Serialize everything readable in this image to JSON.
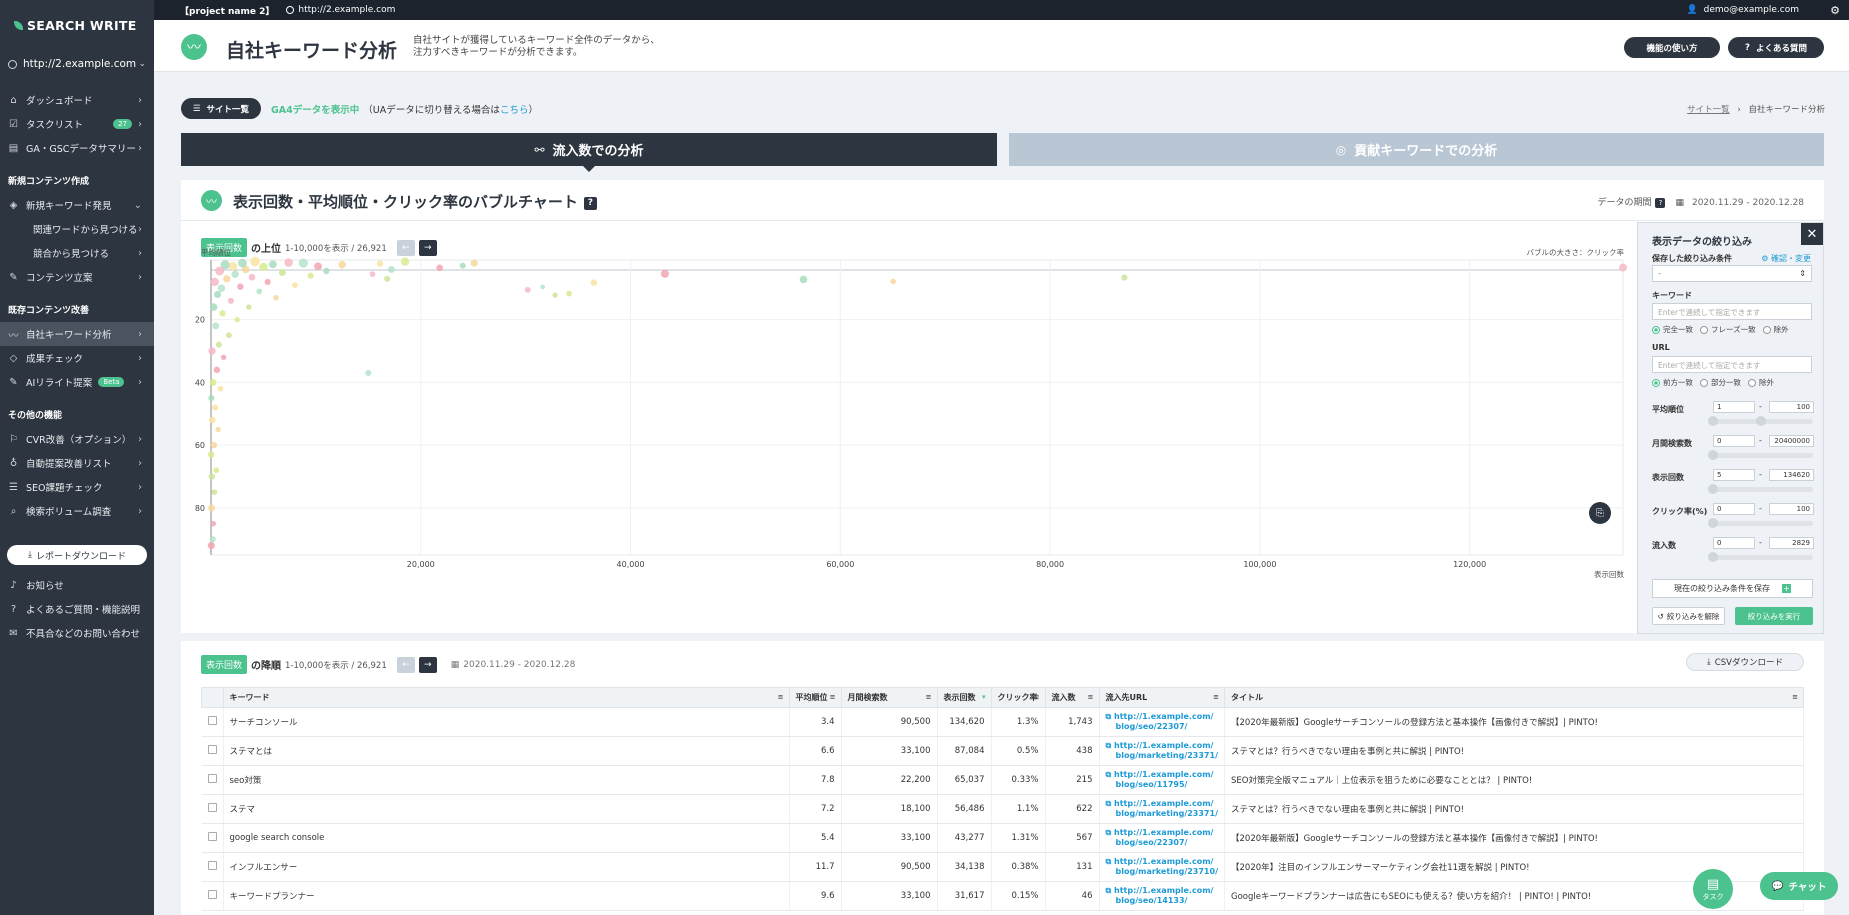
{
  "sidebar": {
    "logo": "SEARCH WRITE",
    "site": "http://2.example.com",
    "items_top": [
      {
        "label": "ダッシュボード",
        "icon": "home-icon"
      },
      {
        "label": "タスクリスト",
        "icon": "checklist-icon",
        "badge": "27"
      },
      {
        "label": "GA・GSCデータサマリー",
        "icon": "chart-icon"
      }
    ],
    "section_new": "新規コンテンツ作成",
    "items_new": [
      {
        "label": "新規キーワード発見",
        "sub": false
      },
      {
        "label": "関連ワードから見つける",
        "sub": true
      },
      {
        "label": "競合から見つける",
        "sub": true
      },
      {
        "label": "コンテンツ立案",
        "sub": false
      }
    ],
    "section_existing": "既存コンテンツ改善",
    "items_existing": [
      {
        "label": "自社キーワード分析",
        "active": true
      },
      {
        "label": "成果チェック"
      },
      {
        "label": "AIリライト提案",
        "badge": "Beta"
      }
    ],
    "section_other": "その他の機能",
    "items_other": [
      {
        "label": "CVR改善（オプション）"
      },
      {
        "label": "自動提案改善リスト"
      },
      {
        "label": "SEO課題チェック"
      },
      {
        "label": "検索ボリューム調査"
      }
    ],
    "report_download": "レポートダウンロード",
    "items_bottom": [
      {
        "label": "お知らせ"
      },
      {
        "label": "よくあるご質問・機能説明"
      },
      {
        "label": "不具合などのお問い合わせ"
      }
    ]
  },
  "topbar": {
    "project": "【project name 2】",
    "url": "http://2.example.com",
    "user": "demo@example.com"
  },
  "header": {
    "title": "自社キーワード分析",
    "desc_line1": "自社サイトが獲得しているキーワード全件のデータから、",
    "desc_line2": "注力すべきキーワードが分析できます。",
    "howto": "機能の使い方",
    "faq": "よくある質問"
  },
  "subbar": {
    "site_list": "サイト一覧",
    "ga4": "GA4データを表示中",
    "ua_pre": "（UAデータに切り替える場合は",
    "ua_link": "こちら",
    "ua_post": "）",
    "bc_link": "サイト一覧",
    "bc_sep": "›",
    "bc_current": "自社キーワード分析"
  },
  "tabs": {
    "active": "流入数での分析",
    "inactive": "貢献キーワードでの分析"
  },
  "chart_panel": {
    "title": "表示回数・平均順位・クリック率のバブルチャート",
    "help": "?",
    "period_label": "データの期間",
    "period": "2020.11.29 - 2020.12.28",
    "metric": "表示回数",
    "top_label": "の上位",
    "range_text": "1-10,000を表示 / 26,921",
    "ylabel": "平均順位",
    "bubble_note": "バブルの大きさ：クリック率",
    "xlabel": "表示回数"
  },
  "chart_data": {
    "type": "scatter",
    "title": "表示回数・平均順位・クリック率のバブルチャート",
    "xlabel": "表示回数",
    "ylabel": "平均順位",
    "size_label": "クリック率",
    "xlim": [
      0,
      134620
    ],
    "ylim": [
      95,
      1
    ],
    "y_reversed": true,
    "xticks": [
      20000,
      40000,
      60000,
      80000,
      100000,
      120000
    ],
    "xtick_labels": [
      "20,000",
      "40,000",
      "60,000",
      "80,000",
      "100,000",
      "120,000"
    ],
    "yticks": [
      20,
      40,
      60,
      80
    ],
    "points": [
      {
        "x": 134620,
        "y": 3.4,
        "size": 1.3
      },
      {
        "x": 87084,
        "y": 6.6,
        "size": 0.5
      },
      {
        "x": 65037,
        "y": 7.8,
        "size": 0.33
      },
      {
        "x": 56486,
        "y": 7.2,
        "size": 1.1
      },
      {
        "x": 43277,
        "y": 5.4,
        "size": 1.31
      },
      {
        "x": 34138,
        "y": 11.7,
        "size": 0.38
      },
      {
        "x": 31617,
        "y": 9.6,
        "size": 0.15
      },
      {
        "x": 36500,
        "y": 8.2,
        "size": 0.6
      },
      {
        "x": 30200,
        "y": 10.5,
        "size": 0.4
      },
      {
        "x": 32800,
        "y": 12.2,
        "size": 0.3
      },
      {
        "x": 25100,
        "y": 2.0,
        "size": 0.9
      },
      {
        "x": 24000,
        "y": 2.8,
        "size": 0.5
      },
      {
        "x": 21800,
        "y": 3.5,
        "size": 0.7
      },
      {
        "x": 18500,
        "y": 1.5,
        "size": 1.4
      },
      {
        "x": 17200,
        "y": 4.0,
        "size": 0.8
      },
      {
        "x": 16100,
        "y": 2.2,
        "size": 0.6
      },
      {
        "x": 15400,
        "y": 5.5,
        "size": 0.4
      },
      {
        "x": 16800,
        "y": 7.0,
        "size": 0.5
      },
      {
        "x": 12500,
        "y": 2.5,
        "size": 1.0
      },
      {
        "x": 11000,
        "y": 4.5,
        "size": 0.6
      },
      {
        "x": 10200,
        "y": 3.0,
        "size": 1.2
      },
      {
        "x": 9500,
        "y": 6.0,
        "size": 0.5
      },
      {
        "x": 8800,
        "y": 2.0,
        "size": 2.0
      },
      {
        "x": 8000,
        "y": 9.0,
        "size": 0.4
      },
      {
        "x": 7400,
        "y": 1.8,
        "size": 1.6
      },
      {
        "x": 6800,
        "y": 5.0,
        "size": 0.8
      },
      {
        "x": 6200,
        "y": 13.0,
        "size": 0.3
      },
      {
        "x": 5900,
        "y": 2.4,
        "size": 1.2
      },
      {
        "x": 5400,
        "y": 8.0,
        "size": 0.5
      },
      {
        "x": 5000,
        "y": 3.2,
        "size": 1.5
      },
      {
        "x": 4600,
        "y": 11.0,
        "size": 0.4
      },
      {
        "x": 4200,
        "y": 1.5,
        "size": 2.2
      },
      {
        "x": 3900,
        "y": 6.5,
        "size": 0.7
      },
      {
        "x": 3600,
        "y": 16.0,
        "size": 0.3
      },
      {
        "x": 3300,
        "y": 4.0,
        "size": 1.1
      },
      {
        "x": 3000,
        "y": 2.0,
        "size": 1.8
      },
      {
        "x": 2800,
        "y": 9.5,
        "size": 0.6
      },
      {
        "x": 2500,
        "y": 20.0,
        "size": 0.3
      },
      {
        "x": 2300,
        "y": 5.5,
        "size": 1.0
      },
      {
        "x": 2100,
        "y": 3.0,
        "size": 1.6
      },
      {
        "x": 1900,
        "y": 14.0,
        "size": 0.5
      },
      {
        "x": 1700,
        "y": 25.0,
        "size": 0.4
      },
      {
        "x": 1500,
        "y": 7.0,
        "size": 0.9
      },
      {
        "x": 1350,
        "y": 2.5,
        "size": 2.0
      },
      {
        "x": 1200,
        "y": 32.0,
        "size": 0.3
      },
      {
        "x": 1100,
        "y": 18.0,
        "size": 0.6
      },
      {
        "x": 1000,
        "y": 10.0,
        "size": 1.0
      },
      {
        "x": 900,
        "y": 42.0,
        "size": 0.4
      },
      {
        "x": 820,
        "y": 4.5,
        "size": 1.8
      },
      {
        "x": 750,
        "y": 28.0,
        "size": 0.5
      },
      {
        "x": 680,
        "y": 55.0,
        "size": 0.3
      },
      {
        "x": 620,
        "y": 12.0,
        "size": 0.9
      },
      {
        "x": 560,
        "y": 36.0,
        "size": 0.6
      },
      {
        "x": 500,
        "y": 68.0,
        "size": 0.4
      },
      {
        "x": 450,
        "y": 22.0,
        "size": 0.8
      },
      {
        "x": 400,
        "y": 48.0,
        "size": 0.5
      },
      {
        "x": 360,
        "y": 8.0,
        "size": 1.5
      },
      {
        "x": 320,
        "y": 75.0,
        "size": 0.4
      },
      {
        "x": 280,
        "y": 60.0,
        "size": 0.6
      },
      {
        "x": 250,
        "y": 16.0,
        "size": 1.1
      },
      {
        "x": 220,
        "y": 85.0,
        "size": 0.3
      },
      {
        "x": 190,
        "y": 40.0,
        "size": 0.8
      },
      {
        "x": 160,
        "y": 90.0,
        "size": 0.5
      },
      {
        "x": 130,
        "y": 52.0,
        "size": 0.7
      },
      {
        "x": 100,
        "y": 30.0,
        "size": 1.0
      },
      {
        "x": 80,
        "y": 70.0,
        "size": 0.6
      },
      {
        "x": 60,
        "y": 80.0,
        "size": 0.8
      },
      {
        "x": 40,
        "y": 45.0,
        "size": 0.5
      },
      {
        "x": 30,
        "y": 92.0,
        "size": 0.9
      },
      {
        "x": 20,
        "y": 63.0,
        "size": 0.6
      },
      {
        "x": 15000,
        "y": 37.0,
        "size": 0.5
      }
    ]
  },
  "filter": {
    "title": "表示データの絞り込み",
    "saved_label": "保存した絞り込み条件",
    "edit": "確認・変更",
    "saved_value": "-",
    "keyword_label": "キーワード",
    "keyword_placeholder": "Enterで連続して指定できます",
    "kw_opts": [
      "完全一致",
      "フレーズ一致",
      "除外"
    ],
    "url_label": "URL",
    "url_placeholder": "Enterで連続して指定できます",
    "url_opts": [
      "前方一致",
      "部分一致",
      "除外"
    ],
    "ranges": [
      {
        "label": "平均順位",
        "min": "1",
        "max": "100"
      },
      {
        "label": "月間検索数",
        "min": "0",
        "max": "20400000"
      },
      {
        "label": "表示回数",
        "min": "5",
        "max": "134620"
      },
      {
        "label": "クリック率(%)",
        "min": "0",
        "max": "100"
      },
      {
        "label": "流入数",
        "min": "0",
        "max": "2829"
      }
    ],
    "save": "現在の絞り込み条件を保存",
    "reset": "絞り込みを解除",
    "apply": "絞り込みを実行"
  },
  "table_panel": {
    "metric": "表示回数",
    "order_label": "の降順",
    "range_text": "1-10,000を表示 / 26,921",
    "period": "2020.11.29 - 2020.12.28",
    "csv": "CSVダウンロード",
    "headers": [
      "キーワード",
      "平均順位",
      "月間検索数",
      "表示回数",
      "クリック率",
      "流入数",
      "流入先URL",
      "タイトル"
    ],
    "rows": [
      {
        "kw": "サーチコンソール",
        "rank": "3.4",
        "vol": "90,500",
        "imp": "134,620",
        "ctr": "1.3%",
        "inflow": "1,743",
        "url1": "http://1.example.com/",
        "url2": "blog/seo/22307/",
        "title": "【2020年最新版】Googleサーチコンソールの登録方法と基本操作【画像付きで解説】| PINTO!"
      },
      {
        "kw": "ステマとは",
        "rank": "6.6",
        "vol": "33,100",
        "imp": "87,084",
        "ctr": "0.5%",
        "inflow": "438",
        "url1": "http://1.example.com/",
        "url2": "blog/marketing/23371/",
        "title": "ステマとは？行うべきでない理由を事例と共に解説 | PINTO!"
      },
      {
        "kw": "seo対策",
        "rank": "7.8",
        "vol": "22,200",
        "imp": "65,037",
        "ctr": "0.33%",
        "inflow": "215",
        "url1": "http://1.example.com/",
        "url2": "blog/seo/11795/",
        "title": "SEO対策完全版マニュアル｜上位表示を狙うために必要なこととは？ | PINTO!"
      },
      {
        "kw": "ステマ",
        "rank": "7.2",
        "vol": "18,100",
        "imp": "56,486",
        "ctr": "1.1%",
        "inflow": "622",
        "url1": "http://1.example.com/",
        "url2": "blog/marketing/23371/",
        "title": "ステマとは？行うべきでない理由を事例と共に解説 | PINTO!"
      },
      {
        "kw": "google search console",
        "rank": "5.4",
        "vol": "33,100",
        "imp": "43,277",
        "ctr": "1.31%",
        "inflow": "567",
        "url1": "http://1.example.com/",
        "url2": "blog/seo/22307/",
        "title": "【2020年最新版】Googleサーチコンソールの登録方法と基本操作【画像付きで解説】| PINTO!"
      },
      {
        "kw": "インフルエンサー",
        "rank": "11.7",
        "vol": "90,500",
        "imp": "34,138",
        "ctr": "0.38%",
        "inflow": "131",
        "url1": "http://1.example.com/",
        "url2": "blog/marketing/23710/",
        "title": "【2020年】注目のインフルエンサーマーケティング会社11選を解説 | PINTO!"
      },
      {
        "kw": "キーワードプランナー",
        "rank": "9.6",
        "vol": "33,100",
        "imp": "31,617",
        "ctr": "0.15%",
        "inflow": "46",
        "url1": "http://1.example.com/",
        "url2": "blog/seo/14133/",
        "title": "Googleキーワードプランナーは広告にもSEOにも使える？使い方を紹介！ | PINTO! | PINTO!"
      }
    ]
  },
  "fab": {
    "task": "タスク",
    "chat": "チャット"
  }
}
